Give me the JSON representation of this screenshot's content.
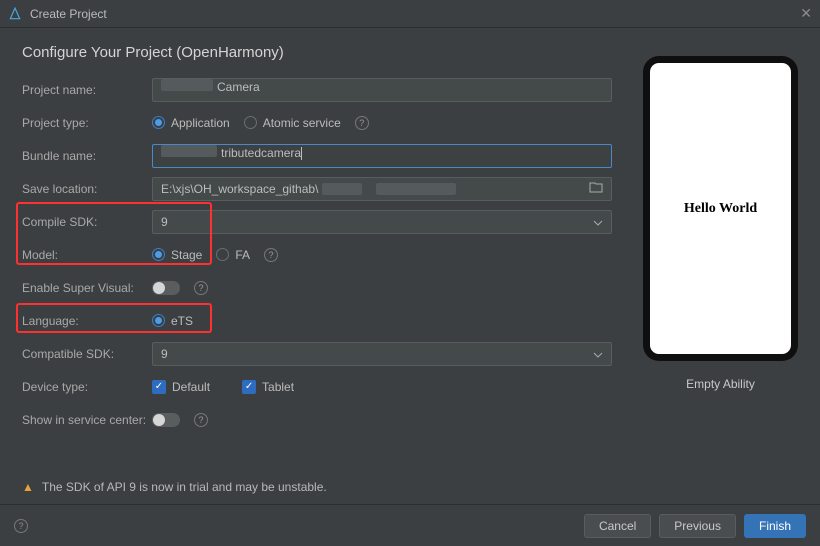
{
  "window": {
    "title": "Create Project"
  },
  "subtitle": "Configure Your Project (OpenHarmony)",
  "form": {
    "project_name": {
      "label": "Project name:",
      "value_suffix": "Camera"
    },
    "project_type": {
      "label": "Project type:",
      "opt_app": "Application",
      "opt_atomic": "Atomic service"
    },
    "bundle_name": {
      "label": "Bundle name:",
      "value_suffix": "tributedcamera"
    },
    "save_location": {
      "label": "Save location:",
      "value_prefix": "E:\\xjs\\OH_workspace_githab\\"
    },
    "compile_sdk": {
      "label": "Compile SDK:",
      "value": "9"
    },
    "model": {
      "label": "Model:",
      "opt_stage": "Stage",
      "opt_fa": "FA"
    },
    "enable_super_visual": {
      "label": "Enable Super Visual:"
    },
    "language": {
      "label": "Language:",
      "opt_ets": "eTS"
    },
    "compatible_sdk": {
      "label": "Compatible SDK:",
      "value": "9"
    },
    "device_type": {
      "label": "Device type:",
      "opt_default": "Default",
      "opt_tablet": "Tablet"
    },
    "show_in_service": {
      "label": "Show in service center:"
    }
  },
  "preview": {
    "screen_text": "Hello World",
    "caption": "Empty Ability"
  },
  "warning": "The SDK of API 9 is now in trial and may be unstable.",
  "footer": {
    "cancel": "Cancel",
    "previous": "Previous",
    "finish": "Finish"
  }
}
